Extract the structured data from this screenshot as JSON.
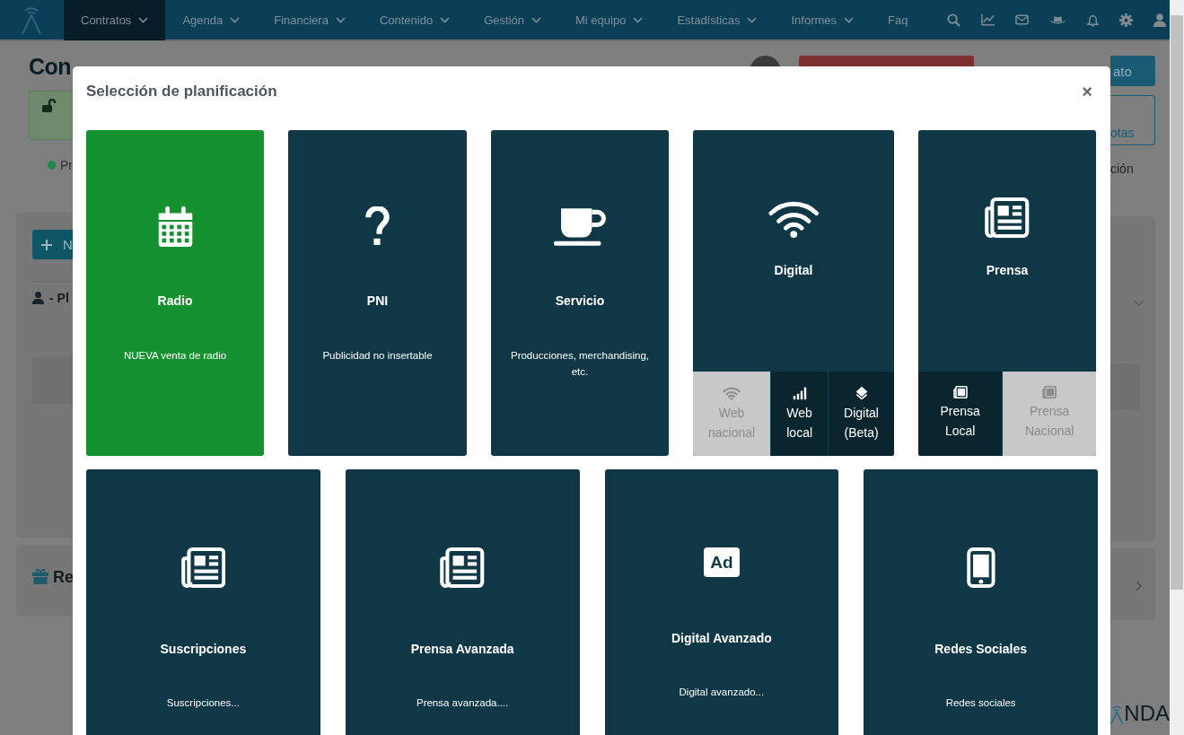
{
  "nav": {
    "items": [
      {
        "label": "Contratos",
        "selected": true,
        "dropdown": true
      },
      {
        "label": "Agenda",
        "selected": false,
        "dropdown": true
      },
      {
        "label": "Financiera",
        "selected": false,
        "dropdown": true
      },
      {
        "label": "Contenido",
        "selected": false,
        "dropdown": true
      },
      {
        "label": "Gestión",
        "selected": false,
        "dropdown": true
      },
      {
        "label": "Mi equipo",
        "selected": false,
        "dropdown": true
      },
      {
        "label": "Estadísticas",
        "selected": false,
        "dropdown": true
      },
      {
        "label": "Informes",
        "selected": false,
        "dropdown": true
      },
      {
        "label": "Faq",
        "selected": false,
        "dropdown": false
      }
    ]
  },
  "page": {
    "title": "Con",
    "status": "Pr",
    "new_button": "N",
    "section": "- Pl",
    "rewards": "Re",
    "save_button": "ato",
    "notes_button": "otas",
    "status_right": "ción",
    "brand": "NDA"
  },
  "modal": {
    "title": "Selección de planificación",
    "close": "×",
    "rows": [
      {
        "tiles": [
          {
            "title": "Radio",
            "subtitle": "NUEVA venta de radio",
            "selected": true
          },
          {
            "title": "PNI",
            "subtitle": "Publicidad no insertable",
            "selected": false
          },
          {
            "title": "Servicio",
            "subtitle": "Producciones, merchandising, etc.",
            "selected": false
          },
          {
            "title": "Digital",
            "selected": false,
            "options": [
              {
                "label": "Web nacional",
                "disabled": true
              },
              {
                "label": "Web local",
                "disabled": false
              },
              {
                "label": "Digital (Beta)",
                "disabled": false
              }
            ]
          },
          {
            "title": "Prensa",
            "selected": false,
            "options": [
              {
                "label": "Prensa Local",
                "disabled": false
              },
              {
                "label": "Prensa Nacional",
                "disabled": true
              }
            ]
          }
        ]
      },
      {
        "tiles": [
          {
            "title": "Suscripciones",
            "subtitle": "Suscripciones...",
            "selected": false
          },
          {
            "title": "Prensa Avanzada",
            "subtitle": "Prensa avanzada....",
            "selected": false
          },
          {
            "title": "Digital Avanzado",
            "subtitle": "Digital avanzado...",
            "selected": false,
            "badge": "Ad"
          },
          {
            "title": "Redes Sociales",
            "subtitle": "Redes sociales",
            "selected": false
          }
        ]
      }
    ]
  }
}
